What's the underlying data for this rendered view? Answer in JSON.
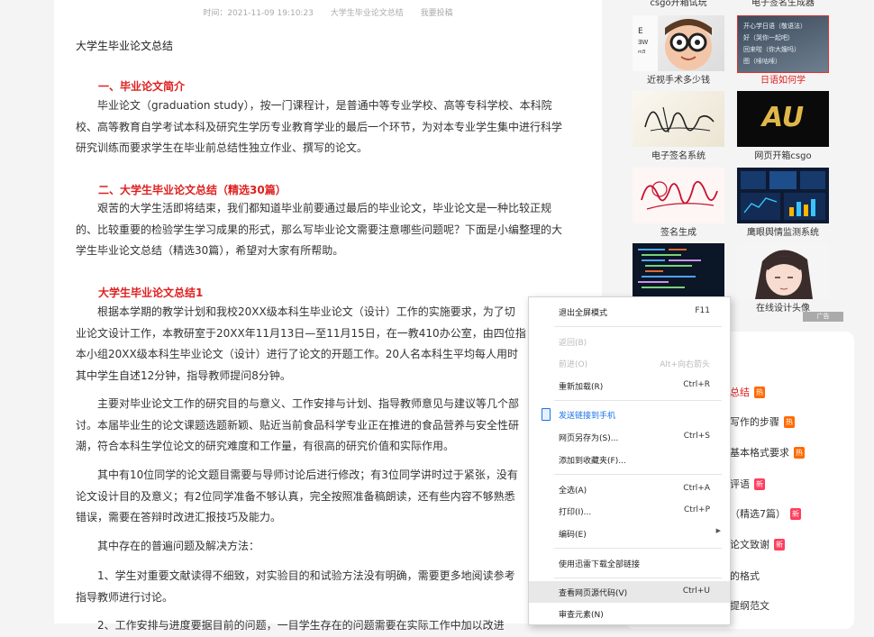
{
  "meta": {
    "time": "时间：2021-11-09 19:10:23",
    "category": "大学生毕业论文总结",
    "submit": "我要投稿"
  },
  "article": {
    "title": "大学生毕业论文总结",
    "h1": "一、毕业论文简介",
    "p1": [
      "毕业论文（graduation study），按一门课程计，是普通中等专业学校、高等专科学校、本科院",
      "校、高等教育自学考试本科及研究生学历专业教育学业的最后一个环节，为对本专业学生集中进行科学",
      "研究训练而要求学生在毕业前总结性独立作业、撰写的论文。"
    ],
    "h2": "二、大学生毕业论文总结（精选30篇）",
    "p2": [
      "艰苦的大学生活即将结束，我们都知道毕业前要通过最后的毕业论文，毕业论文是一种比较正规",
      "的、比较重要的检验学生学习成果的形式，那么写毕业论文需要注意哪些问题呢？下面是小编整理的大",
      "学生毕业论文总结（精选30篇），希望对大家有所帮助。"
    ],
    "h3": "大学生毕业论文总结1",
    "p3": [
      "根据本学期的教学计划和我校20XX级本科生毕业论文（设计）工作的实施要求，为了切",
      "业论文设计工作，本教研室于20XX年11月13日—至11月15日，在一教410办公室，由四位指",
      "本小组20XX级本科生毕业论文（设计）进行了论文的开题工作。20人名本科生平均每人用时",
      "其中学生自述12分钟，指导教师提问8分钟。"
    ],
    "p4": [
      "主要对毕业论文工作的研究目的与意义、工作安排与计划、指导教师意见与建议等几个部",
      "讨。本届毕业生的论文课题选题新颖、贴近当前食品科学专业正在推进的食品营养与安全性研",
      "潮，符合本科生学位论文的研究难度和工作量，有很高的研究价值和实际作用。"
    ],
    "p5": [
      "其中有10位同学的论文题目需要与导师讨论后进行修改；有3位同学讲时过于紧张，没有",
      "论文设计目的及意义；有2位同学准备不够认真，完全按照准备稿朗读，还有些内容不够熟悉",
      "错误，需要在答辩时改进汇报技巧及能力。"
    ],
    "p6": "其中存在的普遍问题及解决方法：",
    "p7": [
      "1、学生对重要文献读得不细致，对实验目的和试验方法没有明确，需要更多地阅读参考",
      "指导教师进行讨论。"
    ],
    "p8": "2、工作安排与进度要据目前的问题，一目学生存在的问题需要在实际工作中加以改进"
  },
  "sidebar": {
    "top_captions": [
      "csgo开箱试玩",
      "电子签名生成器"
    ],
    "thumbs": [
      {
        "caption": "近视手术多少钱",
        "icon": "glasses-boy-photo"
      },
      {
        "caption": "日语如何学",
        "icon": "japanese-notes-photo",
        "lines": [
          "开心学日语（敬语法）",
          "好（哭你一起吧）",
          "回来啦（你大嫂吗）",
          "图（嗦咕嗦）"
        ]
      },
      {
        "caption": "电子签名系统",
        "icon": "signature-photo"
      },
      {
        "caption": "网页开箱csgo",
        "icon": "au-logo-photo",
        "logo": "AU"
      },
      {
        "caption": "签名生成",
        "icon": "red-signature-photo"
      },
      {
        "caption": "鹰眼舆情监测系统",
        "icon": "dashboard-photo"
      },
      {
        "caption": "",
        "icon": "code-screen-photo"
      },
      {
        "caption": "在线设计头像",
        "icon": "anime-avatar-photo"
      }
    ],
    "ad_label": "广告",
    "related": [
      {
        "text": "总结",
        "badge": "热"
      },
      {
        "text": "写作的步骤",
        "badge": "热"
      },
      {
        "text": "基本格式要求",
        "badge": "热"
      },
      {
        "text": "评语",
        "badge": "新"
      },
      {
        "text": "（精选7篇）",
        "badge": "新"
      },
      {
        "text": "论文致谢",
        "badge": "新"
      },
      {
        "text": "的格式",
        "badge": ""
      },
      {
        "text": "提纲范文",
        "badge": ""
      }
    ]
  },
  "context_menu": {
    "items": [
      {
        "label": "退出全屏模式",
        "shortcut": "F11"
      },
      {
        "label": "返回(B)",
        "shortcut": ""
      },
      {
        "label": "前进(O)",
        "shortcut": "Alt+向右箭头"
      },
      {
        "label": "重新加载(R)",
        "shortcut": "Ctrl+R"
      },
      {
        "label": "发送链接到手机",
        "shortcut": ""
      },
      {
        "label": "网页另存为(S)...",
        "shortcut": "Ctrl+S"
      },
      {
        "label": "添加到收藏夹(F)...",
        "shortcut": ""
      },
      {
        "label": "全选(A)",
        "shortcut": "Ctrl+A"
      },
      {
        "label": "打印(I)...",
        "shortcut": "Ctrl+P"
      },
      {
        "label": "编码(E)",
        "shortcut": ""
      },
      {
        "label": "使用迅雷下载全部链接",
        "shortcut": ""
      },
      {
        "label": "查看网页源代码(V)",
        "shortcut": "Ctrl+U"
      },
      {
        "label": "审查元素(N)",
        "shortcut": ""
      }
    ],
    "colors": {
      "highlight": "#e8e8e8",
      "send_link": "#1a73e8"
    }
  }
}
